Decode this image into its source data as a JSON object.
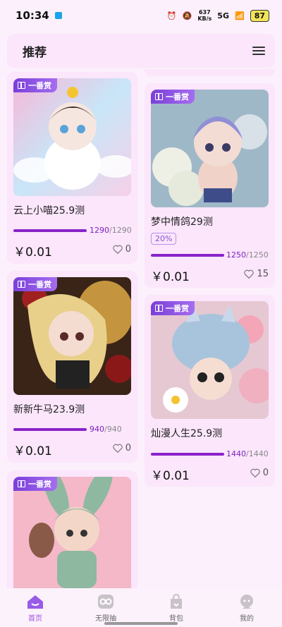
{
  "status_bar": {
    "time": "10:34",
    "net_speed_value": "637",
    "net_speed_unit": "KB/s",
    "network": "5G",
    "battery": "87"
  },
  "header": {
    "title": "推荐"
  },
  "badge_label": "一番赏",
  "cards": [
    {
      "title": "云上小喵25.9测",
      "progress_current": "1290",
      "progress_total": "/1290",
      "price": "￥0.01",
      "likes": "0"
    },
    {
      "title": "梦中情鸽29测",
      "tag": "20%",
      "progress_current": "1250",
      "progress_total": "/1250",
      "price": "￥0.01",
      "likes": "15"
    },
    {
      "title": "新新牛马23.9测",
      "progress_current": "940",
      "progress_total": "/940",
      "price": "￥0.01",
      "likes": "0"
    },
    {
      "title": "灿漫人生25.9测",
      "progress_current": "1440",
      "progress_total": "/1440",
      "price": "￥0.01",
      "likes": "0"
    }
  ],
  "tabs": [
    {
      "label": "首页",
      "icon": "home-icon",
      "active": true
    },
    {
      "label": "无限抽",
      "icon": "infinite-draw-icon",
      "active": false
    },
    {
      "label": "背包",
      "icon": "backpack-icon",
      "active": false
    },
    {
      "label": "我的",
      "icon": "profile-icon",
      "active": false
    }
  ],
  "colors": {
    "accent": "#8a23c8",
    "badge": "#7a3fd8",
    "card_bg": "#fbe6fb"
  }
}
